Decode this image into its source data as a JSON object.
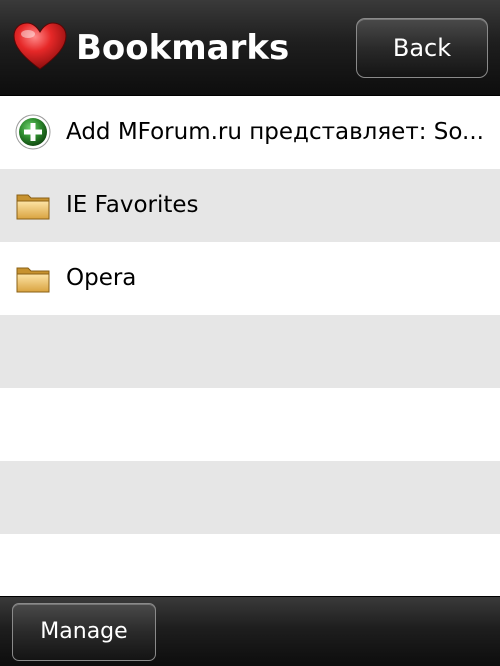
{
  "header": {
    "icon": "heart-icon",
    "title": "Bookmarks",
    "back_label": "Back"
  },
  "list": {
    "items": [
      {
        "icon": "add-circle-icon",
        "label": "Add MForum.ru представляет: So..."
      },
      {
        "icon": "folder-icon",
        "label": "IE Favorites"
      },
      {
        "icon": "folder-icon",
        "label": "Opera"
      }
    ]
  },
  "footer": {
    "manage_label": "Manage"
  },
  "colors": {
    "bar_dark": "#1e1e1e",
    "row_alt": "#e6e6e6",
    "row_plain": "#ffffff",
    "heart": "#e02020",
    "add_green": "#2e8b2e",
    "folder": "#e8b85a"
  }
}
